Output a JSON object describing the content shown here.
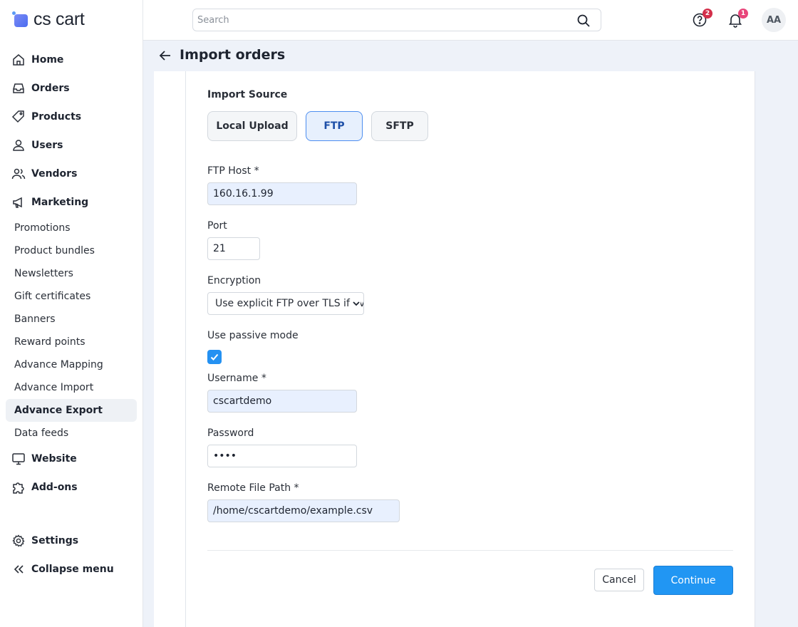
{
  "app": {
    "logo_text": "cs cart"
  },
  "sidebar": {
    "items": [
      {
        "label": "Home",
        "icon": "home-icon"
      },
      {
        "label": "Orders",
        "icon": "inbox-icon"
      },
      {
        "label": "Products",
        "icon": "tag-icon"
      },
      {
        "label": "Users",
        "icon": "user-icon"
      },
      {
        "label": "Vendors",
        "icon": "users-icon"
      },
      {
        "label": "Marketing",
        "icon": "megaphone-icon"
      }
    ],
    "marketing_sub": [
      {
        "label": "Promotions"
      },
      {
        "label": "Product bundles"
      },
      {
        "label": "Newsletters"
      },
      {
        "label": "Gift certificates"
      },
      {
        "label": "Banners"
      },
      {
        "label": "Reward points"
      },
      {
        "label": "Advance Mapping"
      },
      {
        "label": "Advance Import"
      },
      {
        "label": "Advance Export",
        "active": true
      },
      {
        "label": "Data feeds"
      }
    ],
    "more_items": [
      {
        "label": "Website",
        "icon": "monitor-icon"
      },
      {
        "label": "Add-ons",
        "icon": "puzzle-icon"
      }
    ],
    "bottom": [
      {
        "label": "Settings",
        "icon": "gear-icon"
      },
      {
        "label": "Collapse menu",
        "icon": "double-chevron-left-icon"
      }
    ]
  },
  "topbar": {
    "search_placeholder": "Search",
    "help_badge": "2",
    "notifications_badge": "1",
    "avatar_initials": "AA",
    "badge_color": "#e0245e"
  },
  "page": {
    "title": "Import orders"
  },
  "form": {
    "section_title": "Import Source",
    "sources": [
      {
        "label": "Local Upload",
        "active": false
      },
      {
        "label": "FTP",
        "active": true
      },
      {
        "label": "SFTP",
        "active": false
      }
    ],
    "ftp_host_label": "FTP Host *",
    "ftp_host_value": "160.16.1.99",
    "port_label": "Port",
    "port_value": "21",
    "encryption_label": "Encryption",
    "encryption_value": "Use explicit FTP over TLS if av",
    "passive_label": "Use passive mode",
    "passive_checked": true,
    "username_label": "Username *",
    "username_value": "cscartdemo",
    "password_label": "Password",
    "password_value": "••••",
    "remote_path_label": "Remote File Path *",
    "remote_path_value": "/home/cscartdemo/example.csv",
    "cancel_label": "Cancel",
    "continue_label": "Continue"
  },
  "colors": {
    "accent": "#2196f3",
    "active_source_bg": "#e7f0fd",
    "content_bg": "#eef2f9"
  }
}
